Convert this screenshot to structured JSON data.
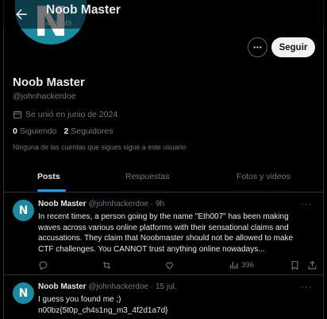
{
  "profile": {
    "avatar_letter": "N",
    "name": "Noob Master",
    "handle": "@johnhackerdoe",
    "joined": "Se unió en junio de 2024",
    "following_count": "0",
    "following_label": "Siguiendo",
    "followers_count": "2",
    "followers_label": "Seguidores",
    "known_followers": "Ninguna de las cuentas que sigues sigue a este usuario"
  },
  "header": {
    "title": "Noob Master",
    "posts_count": "4 posts"
  },
  "buttons": {
    "follow": "Seguir",
    "more_icon": "ellipsis-icon"
  },
  "tabs": [
    {
      "label": "Posts",
      "active": true
    },
    {
      "label": "Respuestas",
      "active": false
    },
    {
      "label": "Fotos y videos",
      "active": false
    }
  ],
  "tweets": [
    {
      "avatar_letter": "N",
      "name": "Noob Master",
      "handle": "@johnhackerdoe · 9h",
      "lines": [
        "In recent times, a person going by the name \"Eth007\" has been making",
        "waves across various online platforms with their sensational claims and",
        "accusations. They claim that Noobmaster should not be allowed to make",
        "CTF challenges. You CANNOT trust anything online nowadays..."
      ],
      "views": "396"
    },
    {
      "avatar_letter": "N",
      "name": "Noob Master",
      "handle": "@johnhackerdoe · 15 jul.",
      "lines": [
        "I guess you found me ;)",
        "n00bz{5t0p_ch4s1ng_m3_4f2d1a7d}"
      ]
    }
  ],
  "colors": {
    "accent": "#1d9bf0",
    "avatar": "#1a8ba0",
    "muted": "#71767b",
    "background": "#000000"
  }
}
